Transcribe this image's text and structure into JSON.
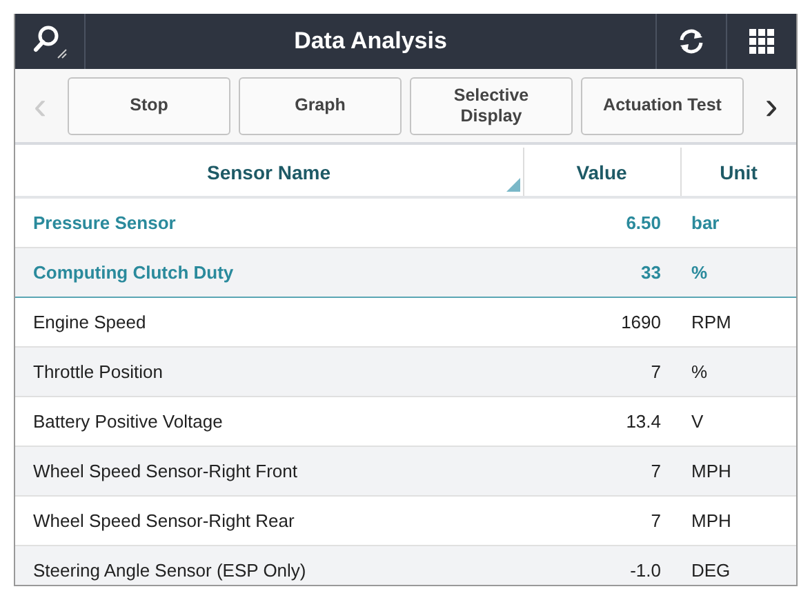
{
  "window": {
    "title": "Data Analysis"
  },
  "toolbar": {
    "prev": {
      "label": "‹",
      "disabled": true
    },
    "buttons": [
      "Stop",
      "Graph",
      "Selective Display",
      "Actuation Test"
    ],
    "next": {
      "label": "›",
      "disabled": false
    }
  },
  "table": {
    "columns": [
      {
        "label": "Sensor Name",
        "sorted": true
      },
      {
        "label": "Value",
        "sorted": false
      },
      {
        "label": "Unit",
        "sorted": false
      }
    ],
    "rows": [
      {
        "name": "Pressure Sensor",
        "value": "6.50",
        "unit": "bar",
        "pinned": true
      },
      {
        "name": "Computing Clutch Duty",
        "value": "33",
        "unit": "%",
        "pinned": true
      },
      {
        "name": "Engine Speed",
        "value": "1690",
        "unit": "RPM",
        "pinned": false
      },
      {
        "name": "Throttle Position",
        "value": "7",
        "unit": "%",
        "pinned": false
      },
      {
        "name": "Battery Positive Voltage",
        "value": "13.4",
        "unit": "V",
        "pinned": false
      },
      {
        "name": "Wheel Speed Sensor-Right Front",
        "value": "7",
        "unit": "MPH",
        "pinned": false
      },
      {
        "name": "Wheel Speed Sensor-Right Rear",
        "value": "7",
        "unit": "MPH",
        "pinned": false
      },
      {
        "name": "Steering Angle Sensor (ESP Only)",
        "value": "-1.0",
        "unit": "DEG",
        "pinned": false
      }
    ]
  }
}
